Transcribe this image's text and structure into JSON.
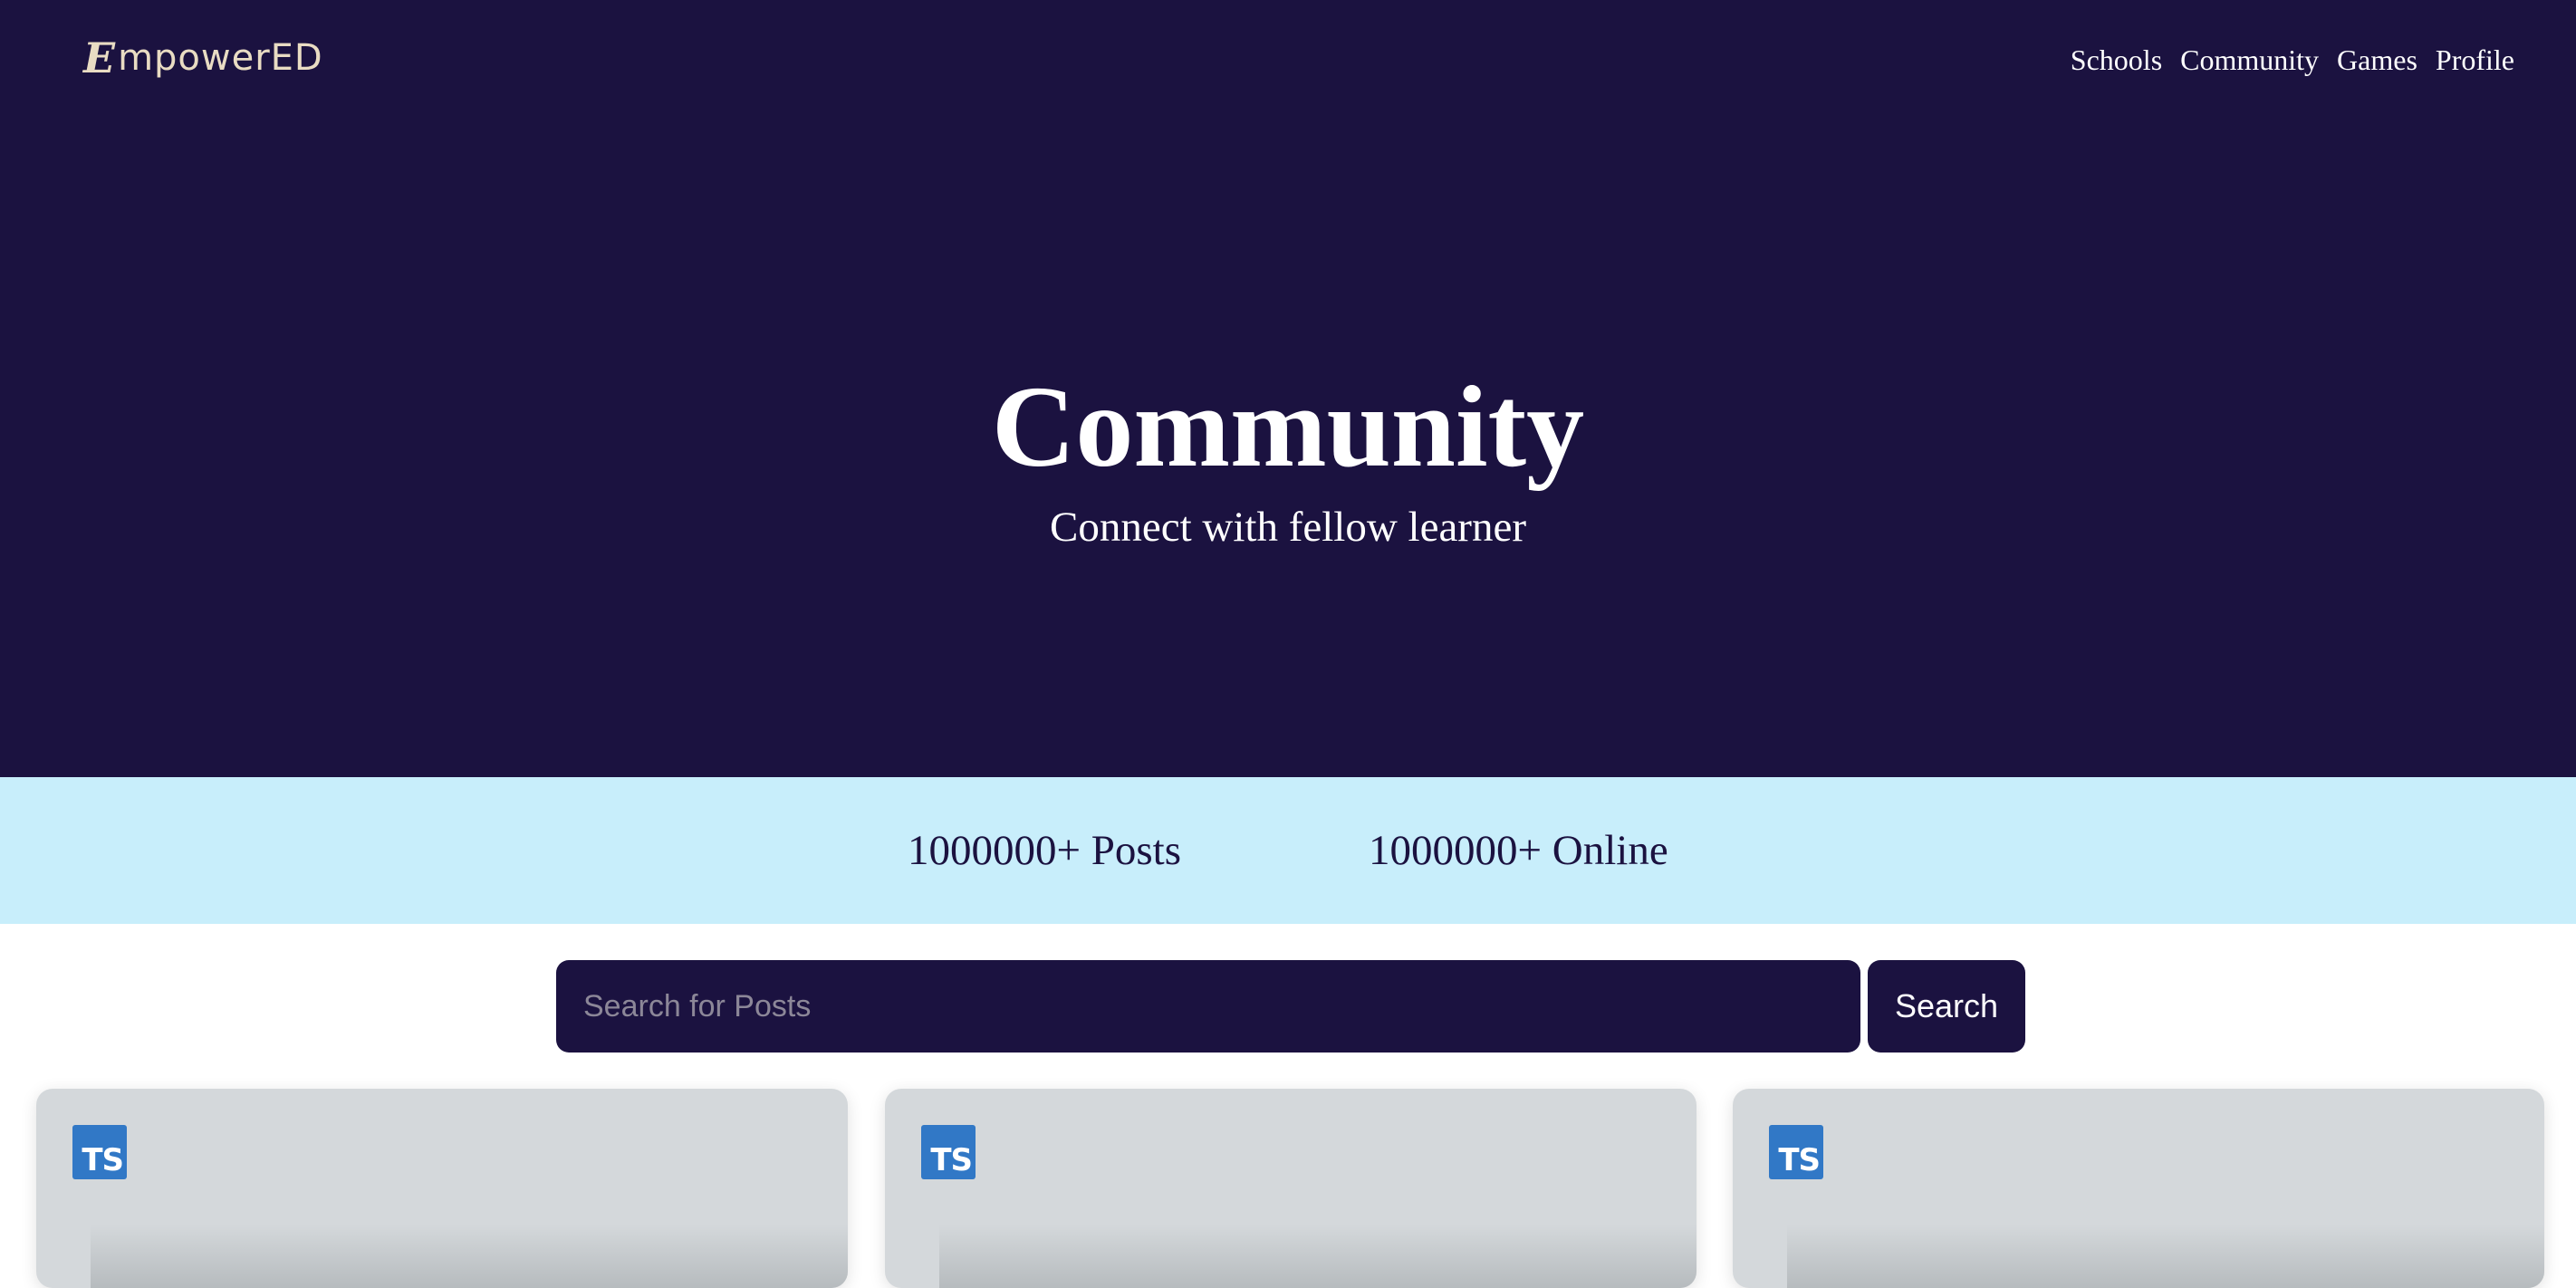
{
  "brand": {
    "mark": "E",
    "name": "mpowerED",
    "color": "#e9dcc3"
  },
  "nav": {
    "items": [
      "Schools",
      "Community",
      "Games",
      "Profile"
    ]
  },
  "hero": {
    "title": "Community",
    "subtitle": "Connect with fellow learner",
    "background": "#1b1240"
  },
  "stats": {
    "posts": "1000000+ Posts",
    "online": "1000000+ Online",
    "background": "#c8eefb"
  },
  "search": {
    "placeholder": "Search for Posts",
    "value": "",
    "button_label": "Search"
  },
  "cards": [
    {
      "icon": "typescript-icon",
      "icon_text": "TS"
    },
    {
      "icon": "typescript-icon",
      "icon_text": "TS"
    },
    {
      "icon": "typescript-icon",
      "icon_text": "TS"
    }
  ],
  "colors": {
    "primary": "#1b1240",
    "accent_light": "#c8eefb",
    "card": "#d4d8db",
    "ts_blue": "#3178c6"
  }
}
